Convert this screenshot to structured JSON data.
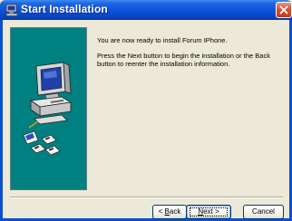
{
  "window": {
    "title": "Start Installation"
  },
  "content": {
    "message_ready": "You are now ready to install Forum IPhone.",
    "message_instructions_line1": "Press the Next button to begin the installation or the Back",
    "message_instructions_line2": "button to reenter the installation information."
  },
  "buttons": {
    "back": {
      "prefix": "< ",
      "mnemonic": "B",
      "rest": "ack"
    },
    "next": {
      "mnemonic": "N",
      "rest": "ext >"
    },
    "cancel": {
      "label": "Cancel"
    }
  },
  "icons": {
    "window_icon": "computer-icon",
    "close": "close-icon",
    "illustration": "computer-installation-illustration"
  },
  "colors": {
    "titlebar": "#0a52d8",
    "sidebar": "#008080",
    "dialog_background": "#ece9d8",
    "close_button": "#d8573a"
  }
}
